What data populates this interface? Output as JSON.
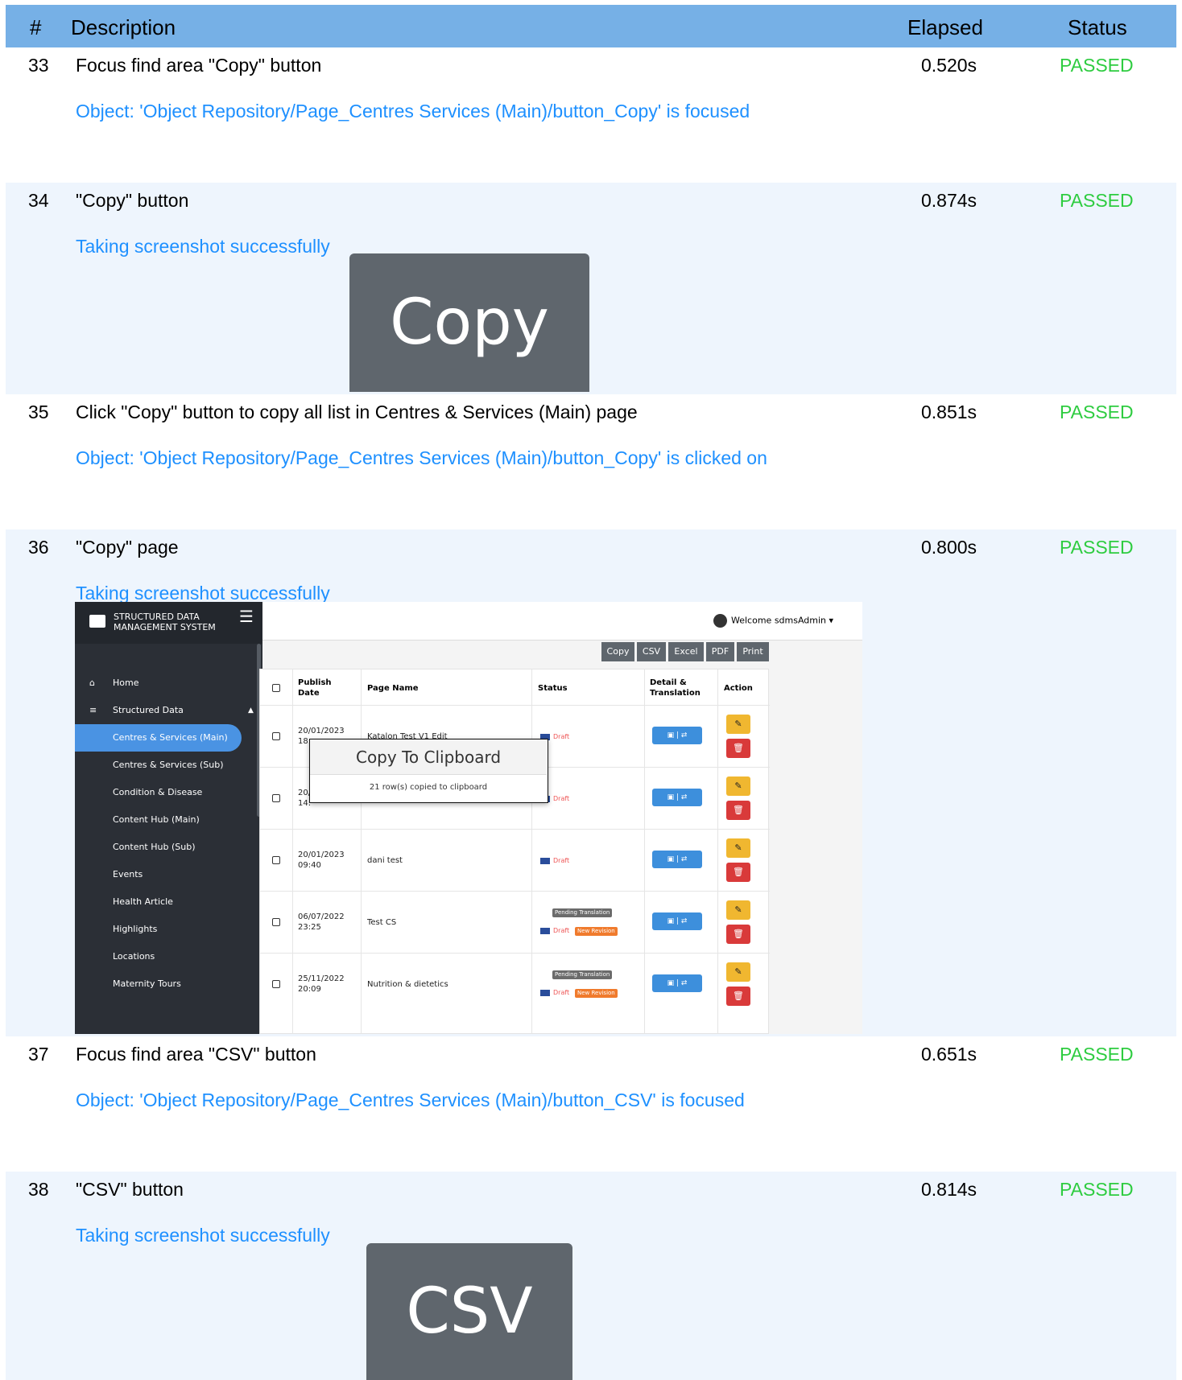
{
  "header": {
    "num": "#",
    "description": "Description",
    "elapsed": "Elapsed",
    "status": "Status"
  },
  "steps": [
    {
      "num": "33",
      "description": "Focus find area \"Copy\" button",
      "elapsed": "0.520s",
      "status": "PASSED",
      "message": "Object: 'Object Repository/Page_Centres  Services (Main)/button_Copy' is focused"
    },
    {
      "num": "34",
      "description": "\"Copy\" button",
      "elapsed": "0.874s",
      "status": "PASSED",
      "message": "Taking screenshot successfully",
      "screenshot_label": "Copy"
    },
    {
      "num": "35",
      "description": "Click \"Copy\" button to copy all list in Centres & Services (Main) page",
      "elapsed": "0.851s",
      "status": "PASSED",
      "message": "Object: 'Object Repository/Page_Centres  Services (Main)/button_Copy' is clicked on"
    },
    {
      "num": "36",
      "description": "\"Copy\" page",
      "elapsed": "0.800s",
      "status": "PASSED",
      "message": "Taking screenshot successfully"
    },
    {
      "num": "37",
      "description": "Focus find area \"CSV\" button",
      "elapsed": "0.651s",
      "status": "PASSED",
      "message": "Object: 'Object Repository/Page_Centres  Services (Main)/button_CSV' is focused"
    },
    {
      "num": "38",
      "description": "\"CSV\" button",
      "elapsed": "0.814s",
      "status": "PASSED",
      "message": "Taking screenshot successfully",
      "screenshot_label": "CSV"
    }
  ],
  "screenshot": {
    "brand_line1": "STRUCTURED DATA",
    "brand_line2": "MANAGEMENT SYSTEM",
    "sidebar": [
      "Home",
      "Structured Data",
      "Centres & Services (Main)",
      "Centres & Services (Sub)",
      "Condition & Disease",
      "Content Hub (Main)",
      "Content Hub (Sub)",
      "Events",
      "Health Article",
      "Highlights",
      "Locations",
      "Maternity Tours"
    ],
    "welcome": "Welcome sdmsAdmin",
    "toolbar": [
      "Copy",
      "CSV",
      "Excel",
      "PDF",
      "Print"
    ],
    "columns": {
      "publish": "Publish",
      "date": "Date",
      "page_name": "Page Name",
      "status": "Status",
      "detail": "Detail &",
      "translation": "Translation",
      "action": "Action"
    },
    "rows": [
      {
        "date": "20/01/2023",
        "time": "18:",
        "name": "Katalon Test V1 Edit",
        "status": "Draft"
      },
      {
        "date": "20/",
        "time": "14:",
        "name": "",
        "status": "Draft"
      },
      {
        "date": "20/01/2023",
        "time": "09:40",
        "name": "dani test",
        "status": "Draft"
      },
      {
        "date": "06/07/2022",
        "time": "23:25",
        "name": "Test CS",
        "status": "Draft",
        "pending": "Pending Translation",
        "revision": "New Revision"
      },
      {
        "date": "25/11/2022",
        "time": "20:09",
        "name": "Nutrition & dietetics",
        "status": "Draft",
        "pending": "Pending Translation",
        "revision": "New Revision"
      }
    ],
    "modal_title": "Copy To Clipboard",
    "modal_body": "21 row(s) copied to clipboard"
  }
}
